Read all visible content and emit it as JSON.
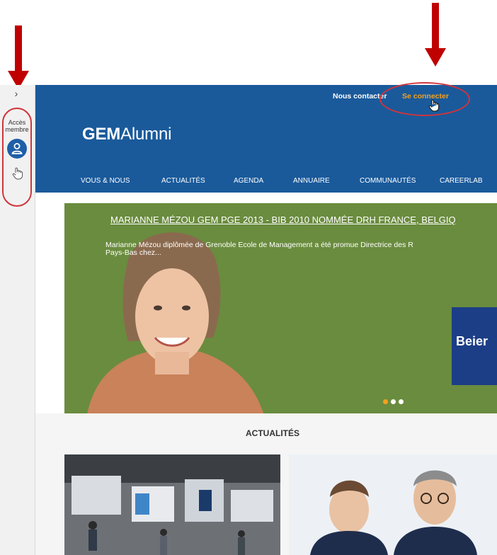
{
  "sidebar": {
    "expand_label": "›",
    "acces_membre": "Accès\nmembre",
    "avatar_icon": "user-icon",
    "hand_icon": "hand-pointer-icon"
  },
  "header": {
    "logo_bold": "GEM",
    "logo_light": "Alumni",
    "contact_label": "Nous contacter",
    "login_label": "Se connecter",
    "menu": [
      "VOUS & NOUS",
      "ACTUALITÉS",
      "AGENDA",
      "ANNUAIRE",
      "COMMUNAUTÉS",
      "CAREERLAB"
    ]
  },
  "hero": {
    "title": "MARIANNE MÉZOU GEM PGE 2013 - BIB 2010 NOMMÉE DRH FRANCE, BELGIQ",
    "description": "Marianne Mézou diplômée de Grenoble Ecole de Management a été promue Directrice des R\nPays-Bas chez...",
    "brand_text": "Beier",
    "slide_count": 3,
    "active_slide": 1
  },
  "news": {
    "section_title": "ACTUALITÉS"
  },
  "colors": {
    "header_blue": "#1a5a9b",
    "accent_orange": "#f4a020",
    "hero_green": "#6a8c3e",
    "annotation_red": "#c00000"
  }
}
